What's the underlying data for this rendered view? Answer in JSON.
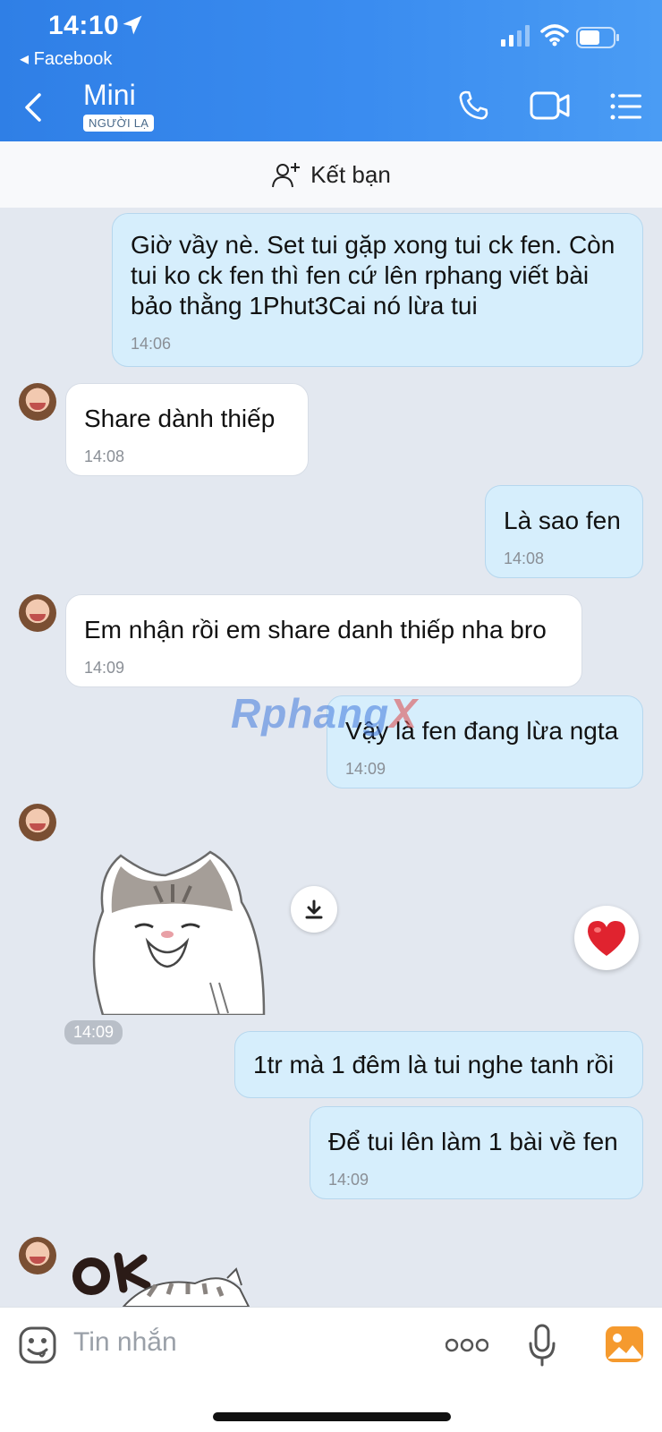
{
  "status": {
    "time": "14:10",
    "back_app": "◂ Facebook"
  },
  "header": {
    "title": "Mini",
    "badge": "NGƯỜI LẠ"
  },
  "add_friend": {
    "label": "Kết bạn"
  },
  "messages": [
    {
      "dir": "out",
      "text": "Giờ vầy nè. Set tui gặp xong tui ck fen. Còn tui ko ck fen thì fen cứ lên rphang viết bài bảo thằng 1Phut3Cai nó lừa tui",
      "time": "14:06"
    },
    {
      "dir": "in",
      "text": "Share dành thiếp",
      "time": "14:08"
    },
    {
      "dir": "out",
      "text": "Là sao fen",
      "time": "14:08"
    },
    {
      "dir": "in",
      "text": "Em nhận rồi em share danh thiếp nha bro",
      "time": "14:09"
    },
    {
      "dir": "out",
      "text": "Vậy là fen đang lừa ngta",
      "time": "14:09"
    },
    {
      "dir": "in",
      "type": "sticker",
      "time": "14:09"
    },
    {
      "dir": "out",
      "text": "1tr mà 1 đêm là tui nghe tanh rồi",
      "time": ""
    },
    {
      "dir": "out",
      "text": "Để tui lên làm 1 bài về fen",
      "time": "14:09"
    },
    {
      "dir": "in",
      "type": "sticker",
      "sticker_text": "OK"
    }
  ],
  "watermark": {
    "main": "Rphang",
    "x": "X"
  },
  "input": {
    "placeholder": "Tin nhắn"
  },
  "icons": [
    "location-arrow-icon",
    "signal-icon",
    "wifi-icon",
    "battery-icon",
    "back-icon",
    "phone-icon",
    "video-icon",
    "menu-icon",
    "add-user-icon",
    "download-icon",
    "heart-icon",
    "emoji-icon",
    "more-icon",
    "mic-icon",
    "gallery-icon"
  ]
}
